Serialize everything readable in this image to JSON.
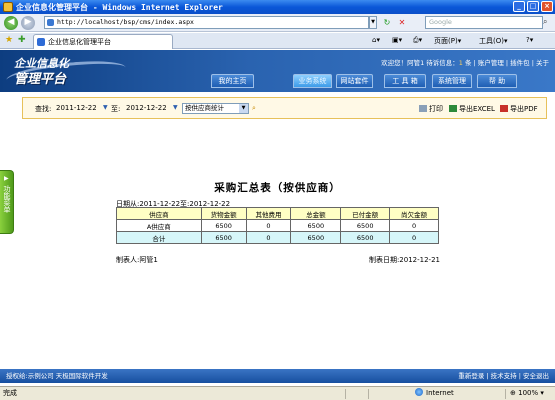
{
  "window": {
    "title": "企业信息化管理平台 - Windows Internet Explorer"
  },
  "addressbar": {
    "url": "http://localhost/bsp/cms/index.aspx",
    "search_placeholder": "Google"
  },
  "browsertab": {
    "label": "企业信息化管理平台"
  },
  "commandbar": {
    "page_label": "页面(P)",
    "tools_label": "工具(O)"
  },
  "header": {
    "logo_line1": "企业信息化",
    "logo_line2": "管理平台",
    "welcome_prefix": "欢迎您！",
    "user": "阿管1",
    "pending_label": "待诉信息：",
    "pending_count": "1",
    "pending_unit": "条",
    "links": [
      "账户管理",
      "插件包",
      "关于"
    ]
  },
  "menu": {
    "items": [
      "我的主页",
      "业务系统",
      "网站套件",
      "工 具 箱",
      "系统管理",
      "帮  助"
    ],
    "active_index": 1
  },
  "toolbar": {
    "find_label": "查找:",
    "date_from": "2011-12-22",
    "to_label": "至:",
    "date_to": "2012-12-22",
    "select_value": "按供应商统计",
    "print_label": "打印",
    "excel_label": "导出EXCEL",
    "pdf_label": "导出PDF"
  },
  "sidetab": {
    "label": "功能菜单"
  },
  "report": {
    "title": "采购汇总表（按供应商）",
    "date_range": "日期从:2011-12-22至:2012-12-22",
    "headers": [
      "供应商",
      "货物金额",
      "其他费用",
      "总金额",
      "已付金额",
      "尚欠金额"
    ],
    "rows": [
      [
        "A供应商",
        "6500",
        "0",
        "6500",
        "6500",
        "0"
      ]
    ],
    "total": [
      "合计",
      "6500",
      "0",
      "6500",
      "6500",
      "0"
    ],
    "maker": "制表人:阿管1",
    "make_date": "制表日期:2012-12-21"
  },
  "footer": {
    "left": "授权给:示例公司  天极国际软件开发",
    "right": "重新登录 | 技术支持 | 安全退出"
  },
  "statusbar": {
    "left": "完成",
    "zone": "Internet",
    "zoom": "100%"
  },
  "colors": {
    "header_blue": "#2a63b0",
    "table_header": "#ffffc4",
    "total_row": "#d6f6f9",
    "side_tab": "#6bb62c"
  }
}
